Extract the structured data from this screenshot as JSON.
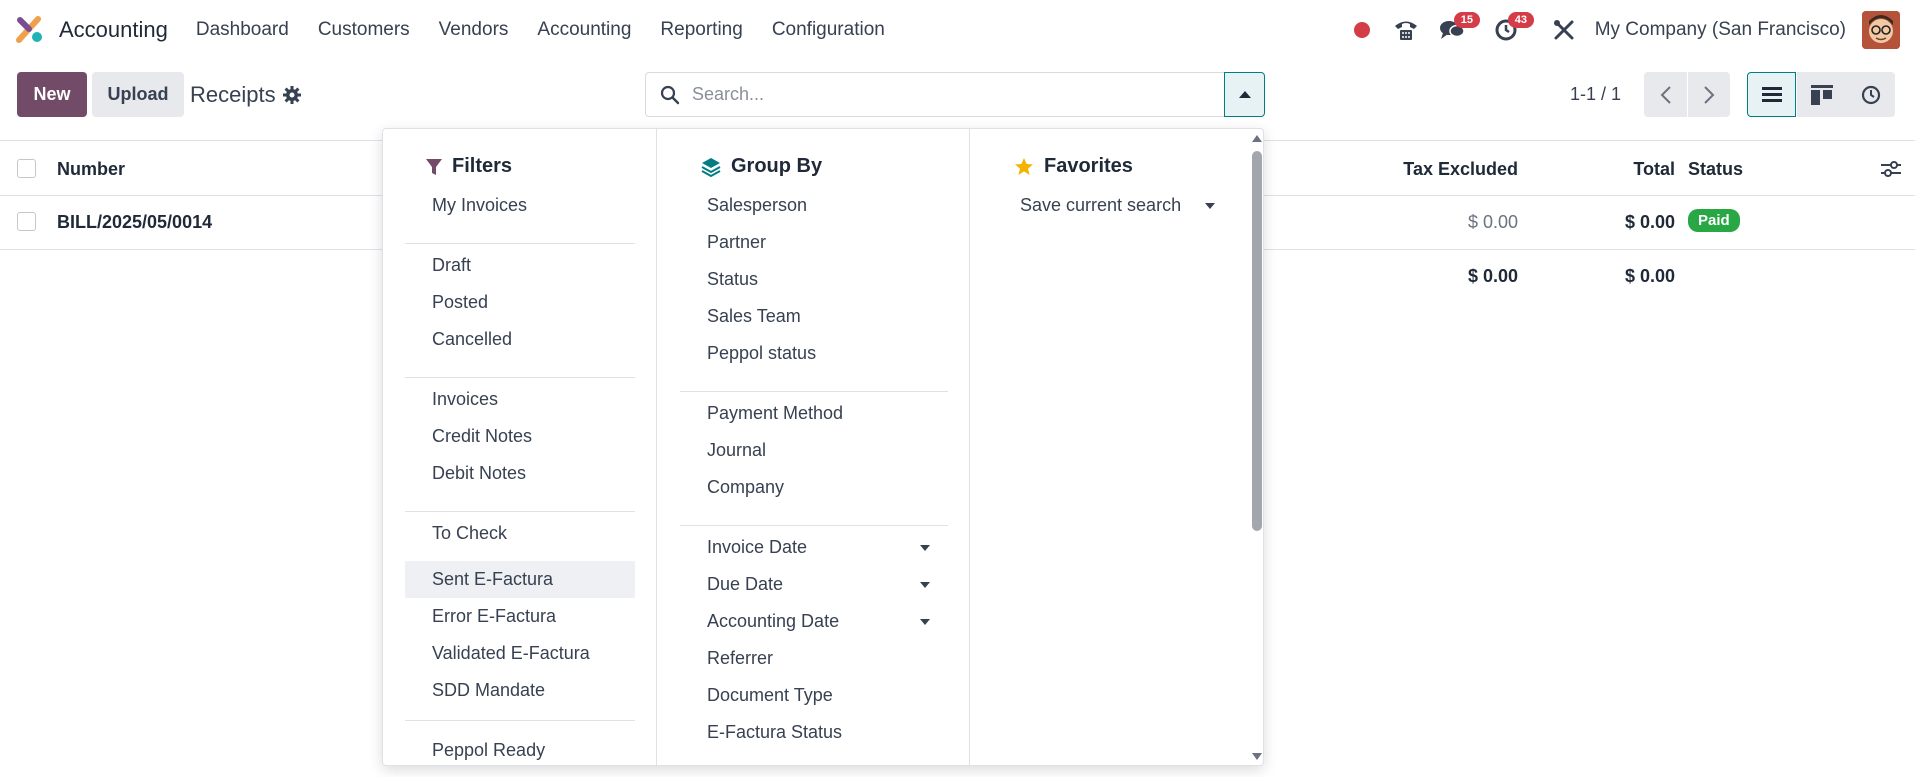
{
  "navbar": {
    "app_name": "Accounting",
    "menu": [
      "Dashboard",
      "Customers",
      "Vendors",
      "Accounting",
      "Reporting",
      "Configuration"
    ],
    "messages_count": "15",
    "activities_count": "43",
    "company": "My Company (San Francisco)"
  },
  "control": {
    "new_label": "New",
    "upload_label": "Upload",
    "breadcrumb": "Receipts",
    "search_placeholder": "Search...",
    "pager": "1-1 / 1"
  },
  "list": {
    "headers": {
      "number": "Number",
      "tax_excluded": "Tax Excluded",
      "total": "Total",
      "status": "Status"
    },
    "rows": [
      {
        "number": "BILL/2025/05/0014",
        "tax_excluded": "$ 0.00",
        "total": "$ 0.00",
        "status": "Paid"
      }
    ],
    "totals": {
      "tax_excluded": "$ 0.00",
      "total": "$ 0.00"
    }
  },
  "dropdown": {
    "filters": {
      "title": "Filters",
      "groups": [
        [
          "My Invoices"
        ],
        [
          "Draft",
          "Posted",
          "Cancelled"
        ],
        [
          "Invoices",
          "Credit Notes",
          "Debit Notes"
        ],
        [
          "To Check",
          "Sent E-Factura",
          "Error E-Factura",
          "Validated E-Factura",
          "SDD Mandate"
        ],
        [
          "Peppol Ready"
        ]
      ],
      "highlighted": "Sent E-Factura"
    },
    "group_by": {
      "title": "Group By",
      "groups": [
        [
          "Salesperson",
          "Partner",
          "Status",
          "Sales Team",
          "Peppol status"
        ],
        [
          "Payment Method",
          "Journal",
          "Company"
        ],
        [
          "Invoice Date",
          "Due Date",
          "Accounting Date",
          "Referrer",
          "Document Type",
          "E-Factura Status"
        ]
      ]
    },
    "favorites": {
      "title": "Favorites",
      "save_label": "Save current search"
    }
  },
  "colors": {
    "primary": "#714b67",
    "accent": "#017e84",
    "success": "#28a745",
    "badge": "#d43c48"
  }
}
